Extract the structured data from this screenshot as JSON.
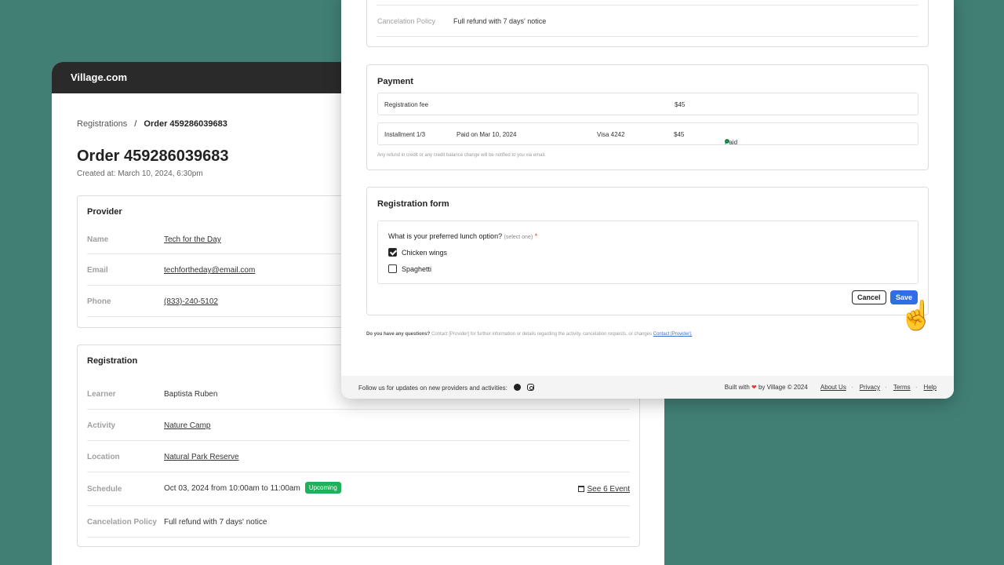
{
  "colors": {
    "background": "#417f75",
    "header": "#2a2a2a",
    "accent": "#2f6fe4",
    "success": "#1db15a"
  },
  "back": {
    "brand": "Village.com",
    "breadcrumb": {
      "parent": "Registrations",
      "separator": "/",
      "current": "Order 459286039683"
    },
    "title": "Order 459286039683",
    "created": "Created at: March 10, 2024, 6:30pm",
    "provider": {
      "title": "Provider",
      "rows": [
        {
          "label": "Name",
          "value": "Tech for the Day"
        },
        {
          "label": "Email",
          "value": "techfortheday@email.com"
        },
        {
          "label": "Phone",
          "value": "(833)-240-5102"
        }
      ]
    },
    "registration": {
      "title": "Registration",
      "rows": [
        {
          "label": "Learner",
          "value": "Baptista Ruben"
        },
        {
          "label": "Activity",
          "value": "Nature Camp"
        },
        {
          "label": "Location",
          "value": "Natural Park Reserve"
        },
        {
          "label": "Schedule",
          "value": "Oct 03, 2024 from 10:00am to 11:00am",
          "badge": "Upcoming",
          "link": "See 6 Event"
        },
        {
          "label": "Cancelation Policy",
          "value": "Full refund with 7 days' notice"
        }
      ]
    }
  },
  "front": {
    "cancelation": {
      "label": "Cancelation Policy",
      "value": "Full refund with 7 days' notice"
    },
    "payment": {
      "title": "Payment",
      "fee": {
        "label": "Registration fee",
        "amount": "$45"
      },
      "installment": {
        "label": "Installment 1/3",
        "date": "Paid on Mar 10, 2024",
        "card": "Visa 4242",
        "amount": "$45",
        "status": "Paid"
      },
      "note": "Any refund in credit or any credit balance change will be notified to you via email."
    },
    "form": {
      "title": "Registration form",
      "question": "What is your preferred lunch option?",
      "question_hint": "(select one)",
      "required_mark": "*",
      "options": [
        {
          "label": "Chicken wings",
          "checked": true
        },
        {
          "label": "Spaghetti",
          "checked": false
        }
      ],
      "cancel_label": "Cancel",
      "save_label": "Save"
    },
    "questions": {
      "lead": "Do you have any questions?",
      "text": " Contact [Provider] for further information or details regarding the activity, cancelation requests, or changes ",
      "link": "Contact [Provider]."
    },
    "footer": {
      "follow": "Follow us for updates on new providers and activities:",
      "built_pre": "Built with",
      "built_post": "by Village © 2024",
      "links": [
        "About Us",
        "Privacy",
        "Terms",
        "Help"
      ]
    }
  }
}
